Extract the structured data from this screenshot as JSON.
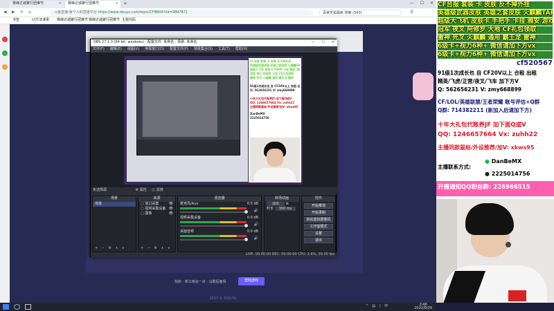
{
  "browser": {
    "tabs": [
      {
        "label": "赛峰达城聚行团推节",
        "active": false
      },
      {
        "label": "赛峰达城聚行团推节",
        "active": true
      }
    ],
    "new_tab": "+",
    "window_controls": [
      "—",
      "☐",
      "✕"
    ],
    "url": "https://www.douyu.com/topic/CF8804?rid=9897871",
    "url_prefix": "斗鱼直播-每个人的直播平台",
    "search_placeholder": "百家天佑最新 搜索 (500)",
    "bookmarks": [
      "书签",
      "UI方法课事",
      "赛峰达城聚行团推节",
      "赛峰达城聚行团推节",
      "主题代码"
    ],
    "footer_text": "刻启 · 新江南谷一点 · 马勒后面贸",
    "footer_button": "登陆游戏",
    "bottom_text": "2017 © DOUYU"
  },
  "obs": {
    "title": "OBS 27.1.3 (64-bit, windows) - 配置文件: 未命名 - 场景: 未命名",
    "menu": [
      "文件(F)",
      "编辑(E)",
      "视图(V)",
      "停靠窗口(D)",
      "配置文件(P)",
      "场景集合(S)",
      "工具(T)",
      "帮助(H)"
    ],
    "context_bar": [
      "未选择源",
      "属性",
      "滤镜"
    ],
    "docks": {
      "scenes": {
        "title": "场景",
        "items": [
          "场景"
        ]
      },
      "sources": {
        "title": "来源",
        "items": [
          "窗口采集",
          "视频采集设备",
          "图像"
        ]
      },
      "mixer": {
        "title": "混音器",
        "channels": [
          {
            "name": "麦克风/Aux",
            "volume": "0.0 dB",
            "level": 0.85
          },
          {
            "name": "视频采集设备",
            "volume": "0.0 dB",
            "level": 0.6
          },
          {
            "name": "桌面音频",
            "volume": "0.0 dB",
            "level": 0.7
          }
        ]
      },
      "transitions": {
        "title": "转场动画",
        "value": "淡出",
        "duration_label": "时长",
        "duration": "300 ms"
      },
      "controls": {
        "title": "控件",
        "buttons": [
          "开始推流",
          "开始录制",
          "启动虚拟摄像机",
          "工作室模式",
          "设置",
          "退出"
        ]
      }
    },
    "status": "LIVE: 00:00:00  REC: 00:00:00  CPU: 2.6%, 30.00 fps"
  },
  "overlay": {
    "lines": [
      {
        "text": "CF台服 套装 卡 皮肤 反不掉外挂",
        "style": "ovg"
      },
      {
        "text": "英雄级武器皮肤 英雄之套皮肤 火麒麟TAR技能",
        "style": "ovg"
      },
      {
        "text": "超级大飞机 皮肤卡 手把手 卡挂 雅安 游戏",
        "style": "ovg"
      },
      {
        "text": "冠军 夜叉 阿修罗 大地 CF礼包领取",
        "style": "ovg"
      },
      {
        "text": "雷神 死叉 火麒麟 通用 霸王龙 雷神",
        "style": "ovg"
      },
      {
        "text": "6级卡+视力6种+ 微信请加下方vx",
        "style": "ovg"
      },
      {
        "text": "6级卡+视力6种+ 微信请加下方vx",
        "style": "ovg"
      },
      {
        "text": "cf520567",
        "style": "ovb"
      },
      {
        "text": "91级1次成长也 自 CF20V以上 合租 出租",
        "style": "ovk"
      },
      {
        "text": "精英/飞虎/正营/夜叉/飞车 加下方V",
        "style": "ovk"
      },
      {
        "text": "Q: 562656231 V: zmy668899",
        "style": "ovk"
      },
      {
        "text": "CF/LOL/英雄联盟/王者荣耀 账号评估+Q群",
        "style": "ovb"
      },
      {
        "text": "Q群: 714382211 (新加入后请加下方)",
        "style": "ovb"
      },
      {
        "text": "十年大礼包代账养JF 加下面Q或V",
        "style": "ovr"
      },
      {
        "text": "QQ: 1246657664 Vx: zuhh22",
        "style": "ovr"
      },
      {
        "text": "主播同款鼠标/外设推荐/加V: xkws95",
        "style": "ovr"
      },
      {
        "text": "主播联系方式:",
        "style": "ovk"
      },
      {
        "text": "DanBeMX",
        "style": "ovk"
      },
      {
        "text": "2225014756",
        "style": "ovk"
      },
      {
        "text": "开播通知QQ粉丝群: 226966515",
        "style": "ovk"
      }
    ]
  },
  "taskbar": {
    "time": "2:46",
    "date": "2022/8/29",
    "apps": [
      "start",
      "search",
      "task-view",
      "chrome",
      "explorer",
      "obs"
    ]
  }
}
